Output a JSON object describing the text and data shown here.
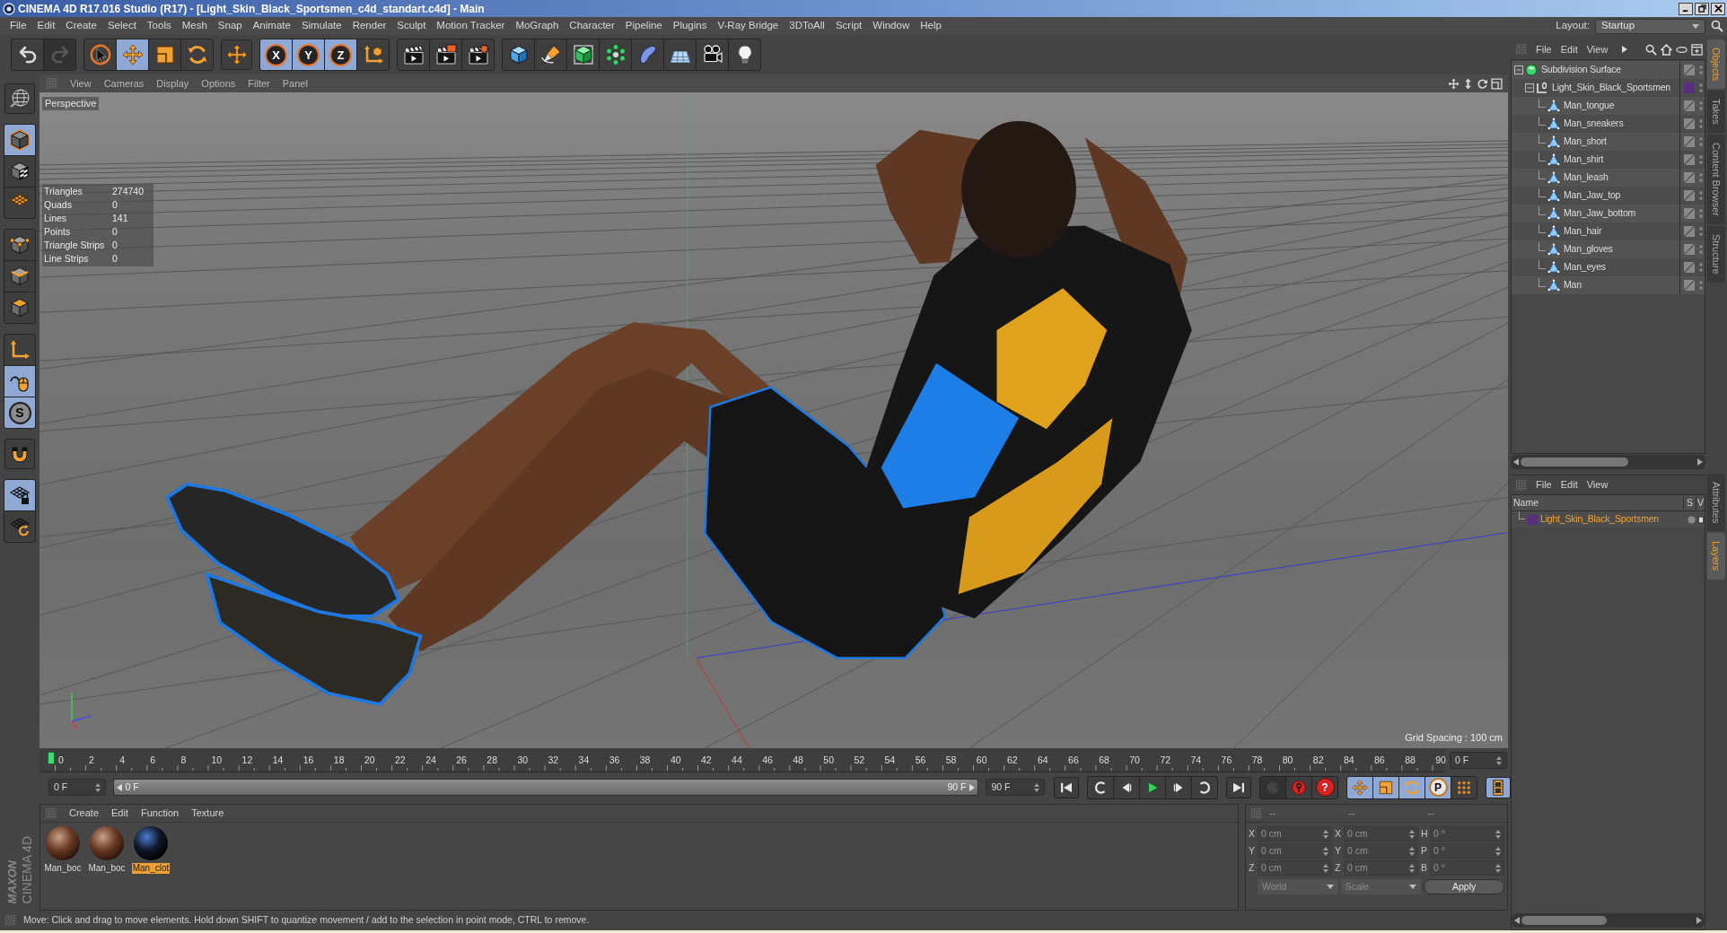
{
  "window": {
    "title": "CINEMA 4D R17.016 Studio (R17) - [Light_Skin_Black_Sportsmen_c4d_standart.c4d] - Main"
  },
  "menu_bar": {
    "items": [
      "File",
      "Edit",
      "Create",
      "Select",
      "Tools",
      "Mesh",
      "Snap",
      "Animate",
      "Simulate",
      "Render",
      "Sculpt",
      "Motion Tracker",
      "MoGraph",
      "Character",
      "Pipeline",
      "Plugins",
      "V-Ray Bridge",
      "3DToAll",
      "Script",
      "Window",
      "Help"
    ],
    "layout_label": "Layout:",
    "layout_value": "Startup"
  },
  "toolbar": {
    "groups": [
      [
        {
          "kind": "undo",
          "active": false,
          "disabled": false
        },
        {
          "kind": "redo",
          "active": false,
          "disabled": true
        }
      ],
      [
        {
          "kind": "select",
          "active": false
        },
        {
          "kind": "move",
          "active": true
        },
        {
          "kind": "scale",
          "active": false
        },
        {
          "kind": "rotate",
          "active": false
        }
      ],
      [
        {
          "kind": "recent",
          "active": false
        }
      ],
      [
        {
          "kind": "axis_lock",
          "label": "X",
          "active": true
        },
        {
          "kind": "axis_lock",
          "label": "Y",
          "active": true
        },
        {
          "kind": "axis_lock",
          "label": "Z",
          "active": true
        },
        {
          "kind": "coord",
          "active": false
        }
      ],
      [
        {
          "kind": "render_view",
          "active": false
        },
        {
          "kind": "render_pv",
          "active": false
        },
        {
          "kind": "render_settings",
          "active": false
        }
      ],
      [
        {
          "kind": "cube",
          "active": false
        },
        {
          "kind": "pen",
          "active": false
        },
        {
          "kind": "subdiv",
          "active": false
        },
        {
          "kind": "cloner",
          "active": false
        },
        {
          "kind": "deformer",
          "active": false
        },
        {
          "kind": "floor",
          "active": false
        },
        {
          "kind": "camera",
          "active": false
        },
        {
          "kind": "light",
          "active": false
        }
      ]
    ]
  },
  "mode_toolbar": {
    "groups": [
      [
        {
          "kind": "globe",
          "active": false
        }
      ],
      [
        {
          "kind": "model",
          "active": true
        },
        {
          "kind": "texture",
          "active": false
        },
        {
          "kind": "workplane",
          "active": false
        }
      ],
      [
        {
          "kind": "points",
          "active": false
        },
        {
          "kind": "edges",
          "active": false
        },
        {
          "kind": "polygons",
          "active": false
        }
      ],
      [
        {
          "kind": "axis",
          "active": false
        },
        {
          "kind": "tweak",
          "active": true
        },
        {
          "kind": "solo",
          "label": "S",
          "active": true
        }
      ],
      [
        {
          "kind": "snap",
          "active": false
        }
      ],
      [
        {
          "kind": "lock_grid",
          "active": true
        },
        {
          "kind": "rotate_grid",
          "active": false
        }
      ]
    ]
  },
  "viewport": {
    "menu": [
      "View",
      "Cameras",
      "Display",
      "Options",
      "Filter",
      "Panel"
    ],
    "camera": "Perspective",
    "stats": [
      {
        "label": "Triangles",
        "value": "274740"
      },
      {
        "label": "Quads",
        "value": "0"
      },
      {
        "label": "Lines",
        "value": "141"
      },
      {
        "label": "Points",
        "value": "0"
      },
      {
        "label": "Triangle Strips",
        "value": "0"
      },
      {
        "label": "Line Strips",
        "value": "0"
      }
    ],
    "grid_spacing": "Grid Spacing : 100 cm"
  },
  "timeline": {
    "frames": [
      "0",
      "2",
      "4",
      "6",
      "8",
      "10",
      "12",
      "14",
      "16",
      "18",
      "20",
      "22",
      "24",
      "26",
      "28",
      "30",
      "32",
      "34",
      "36",
      "38",
      "40",
      "42",
      "44",
      "46",
      "48",
      "50",
      "52",
      "54",
      "56",
      "58",
      "60",
      "62",
      "64",
      "66",
      "68",
      "70",
      "72",
      "74",
      "76",
      "78",
      "80",
      "82",
      "84",
      "86",
      "88",
      "90"
    ],
    "playhead": {
      "level": 0
    },
    "current_frame": "0 F"
  },
  "transport": {
    "start": "0 F",
    "range": {
      "start": "0 F",
      "end": "90 F",
      "level": 1
    },
    "end": "90 F",
    "groups": [
      [
        {
          "kind": "go_start",
          "active": false
        }
      ],
      [
        {
          "kind": "prev_key",
          "active": false
        },
        {
          "kind": "prev_frame",
          "active": false
        },
        {
          "kind": "play",
          "active": false
        },
        {
          "kind": "next_frame",
          "active": false
        },
        {
          "kind": "next_key",
          "active": false
        }
      ],
      [
        {
          "kind": "go_end",
          "active": false
        }
      ],
      [
        {
          "kind": "keyframe",
          "active": false,
          "disabled": true
        },
        {
          "kind": "record",
          "active": false,
          "disabled": false
        },
        {
          "kind": "autokey",
          "label": "?",
          "active": false,
          "disabled": false
        }
      ],
      [
        {
          "kind": "position",
          "active": true
        },
        {
          "kind": "scale",
          "active": true
        },
        {
          "kind": "rotate",
          "active": true
        },
        {
          "kind": "param",
          "label": "P",
          "active": true
        },
        {
          "kind": "pla",
          "active": false
        }
      ],
      [
        {
          "kind": "dopesheet",
          "active": true
        }
      ]
    ]
  },
  "logo": {
    "lines": [
      "MAXON",
      "CINEMA 4D"
    ]
  },
  "material_manager": {
    "menu": [
      "Create",
      "Edit",
      "Function",
      "Texture"
    ],
    "materials": [
      {
        "name": "Man_boc",
        "kind": "skin",
        "selected": false
      },
      {
        "name": "Man_boc",
        "kind": "skin",
        "selected": false
      },
      {
        "name": "Man_clot",
        "kind": "cloth",
        "selected": true
      }
    ]
  },
  "coordinates": {
    "headers": [
      "--",
      "--",
      "--"
    ],
    "rows": [
      [
        {
          "axis": "X",
          "value": "0 cm"
        },
        {
          "axis": "X",
          "value": "0 cm"
        },
        {
          "axis": "H",
          "value": "0 °"
        }
      ],
      [
        {
          "axis": "Y",
          "value": "0 cm"
        },
        {
          "axis": "Y",
          "value": "0 cm"
        },
        {
          "axis": "P",
          "value": "0 °"
        }
      ],
      [
        {
          "axis": "Z",
          "value": "0 cm"
        },
        {
          "axis": "Z",
          "value": "0 cm"
        },
        {
          "axis": "B",
          "value": "0 °"
        }
      ]
    ],
    "dropdowns": [
      {
        "value": "World",
        "disabled": true
      },
      {
        "value": "Scale",
        "disabled": true
      }
    ],
    "apply": "Apply"
  },
  "status_bar": {
    "text": "Move: Click and drag to move elements. Hold down SHIFT to quantize movement / add to the selection in point mode, CTRL to remove."
  },
  "object_manager": {
    "menu": [
      "File",
      "Edit",
      "View"
    ],
    "tree": [
      {
        "name": "Subdivision Surface",
        "kind": "subdivision",
        "expanded": true,
        "children": [
          {
            "name": "Light_Skin_Black_Sportsmen",
            "kind": "null",
            "expanded": true,
            "color": "#5b2d7e",
            "children": [
              {
                "name": "Man_tongue",
                "kind": "polygon"
              },
              {
                "name": "Man_sneakers",
                "kind": "polygon"
              },
              {
                "name": "Man_short",
                "kind": "polygon"
              },
              {
                "name": "Man_shirt",
                "kind": "polygon"
              },
              {
                "name": "Man_leash",
                "kind": "polygon"
              },
              {
                "name": "Man_Jaw_top",
                "kind": "polygon"
              },
              {
                "name": "Man_Jaw_bottom",
                "kind": "polygon"
              },
              {
                "name": "Man_hair",
                "kind": "polygon"
              },
              {
                "name": "Man_gloves",
                "kind": "polygon"
              },
              {
                "name": "Man_eyes",
                "kind": "polygon"
              },
              {
                "name": "Man",
                "kind": "polygon"
              }
            ]
          }
        ]
      }
    ]
  },
  "layer_manager": {
    "menu": [
      "File",
      "Edit",
      "View"
    ],
    "columns": [
      "Name",
      "S",
      "V"
    ],
    "layers": [
      {
        "name": "Light_Skin_Black_Sportsmen",
        "color": "#5b2d7e",
        "selected": true
      }
    ]
  },
  "side_tabs": {
    "top": [
      {
        "label": "Objects",
        "selected": true
      },
      {
        "label": "Takes",
        "selected": false
      },
      {
        "label": "Content Browser",
        "selected": false
      },
      {
        "label": "Structure",
        "selected": false
      }
    ],
    "bottom": [
      {
        "label": "Attributes",
        "selected": false
      },
      {
        "label": "Layers",
        "selected": true
      }
    ]
  }
}
